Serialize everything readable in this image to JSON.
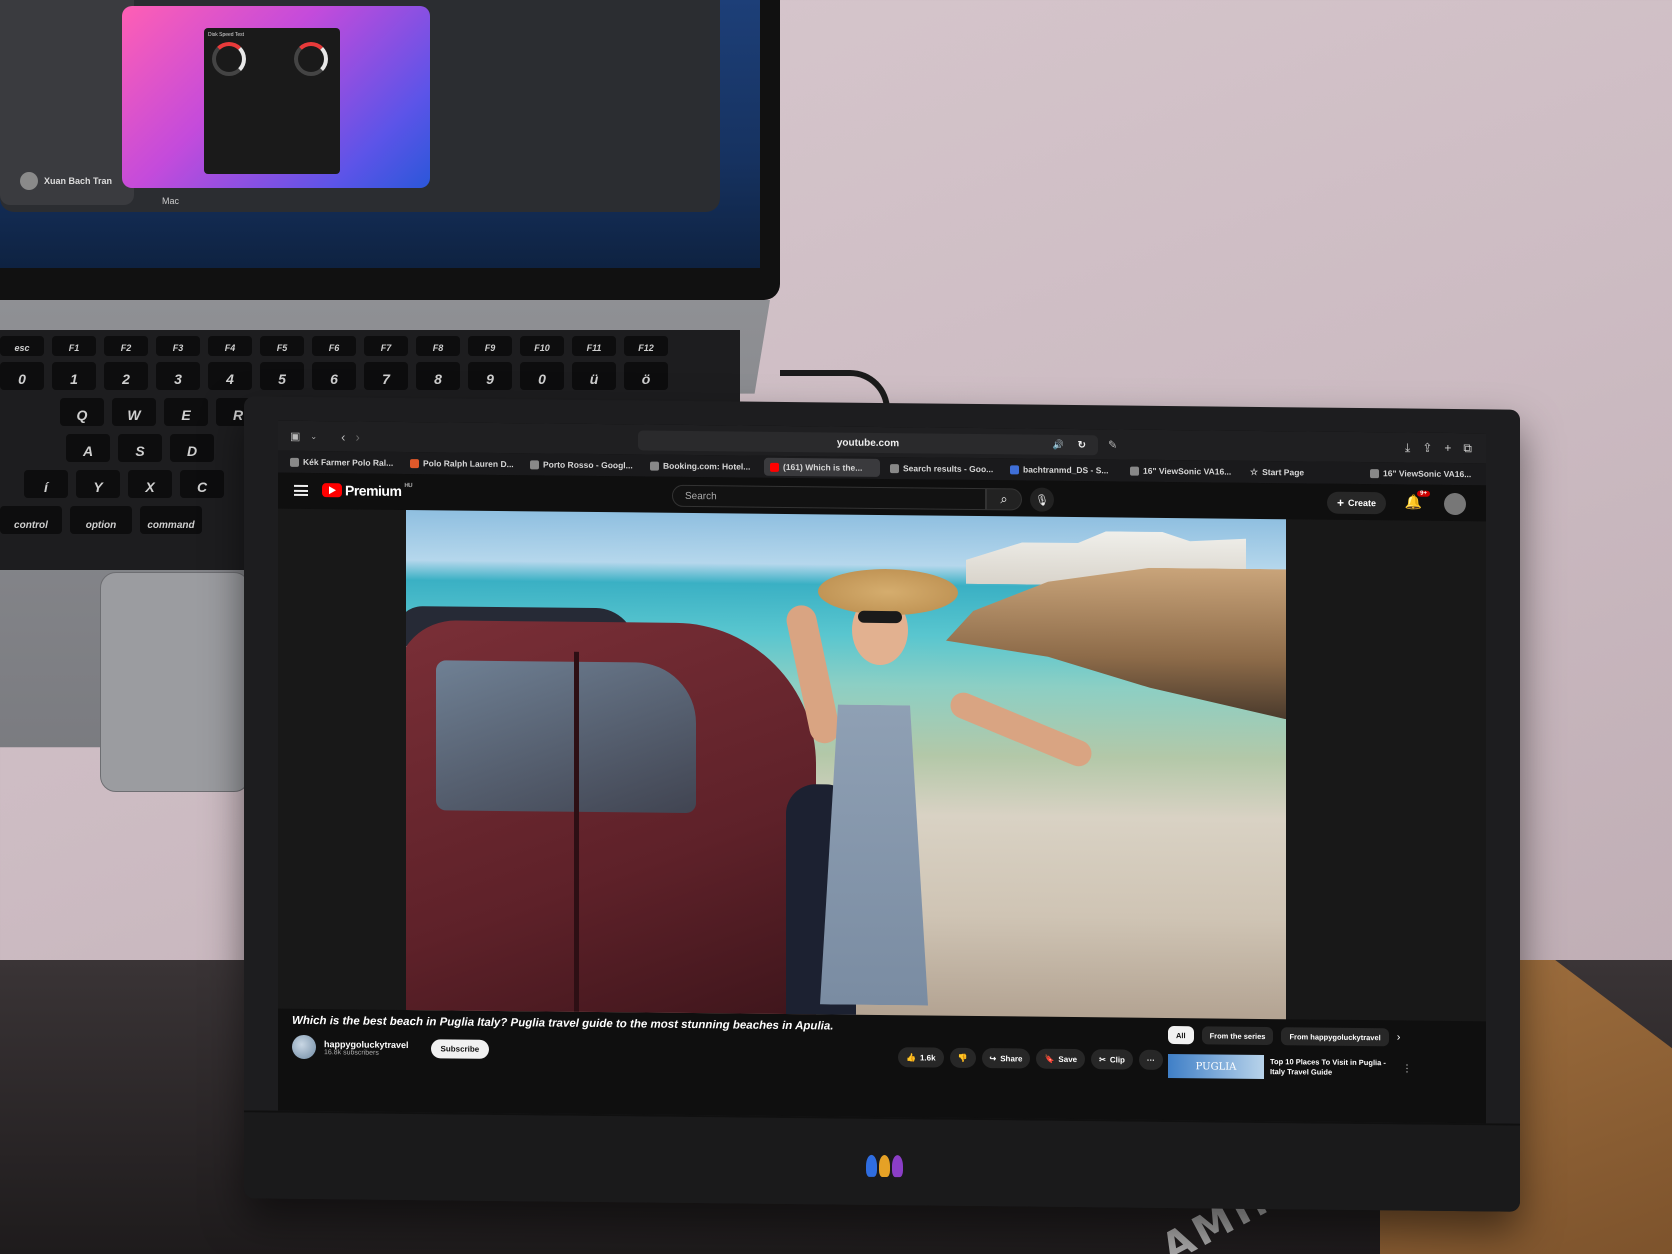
{
  "laptop": {
    "user_name": "Xuan Bach Tran",
    "mac_label": "Mac",
    "app_title": "Disk Speed Test",
    "keyboard_rows": [
      [
        "esc",
        "F1",
        "F2",
        "F3",
        "F4",
        "F5",
        "F6",
        "F7",
        "F8",
        "F9",
        "F10",
        "F11",
        "F12"
      ],
      [
        "0",
        "1",
        "2",
        "3",
        "4",
        "5",
        "6",
        "7",
        "8",
        "9",
        "0",
        "ü",
        "ö"
      ],
      [
        "Q",
        "W",
        "E",
        "R"
      ],
      [
        "A",
        "S",
        "D"
      ],
      [
        "í",
        "Y",
        "X",
        "C"
      ],
      [
        "control",
        "option",
        "command"
      ]
    ]
  },
  "browser": {
    "address": "youtube.com",
    "tabs": [
      {
        "label": "Kék Farmer Polo Ral..."
      },
      {
        "label": "Polo Ralph Lauren D..."
      },
      {
        "label": "Porto Rosso - Googl..."
      },
      {
        "label": "Booking.com: Hotel..."
      },
      {
        "label": "(161) Which is the...",
        "active": true
      },
      {
        "label": "Search results - Goo..."
      },
      {
        "label": "bachtranmd_DS - S..."
      },
      {
        "label": "16\" ViewSonic VA16..."
      },
      {
        "label": "Start Page"
      },
      {
        "label": "16\" ViewSonic VA16..."
      }
    ]
  },
  "youtube": {
    "logo_text": "Premium",
    "region": "HU",
    "search_placeholder": "Search",
    "create_label": "Create",
    "notifications": "9+",
    "video_title": "Which is the best beach in Puglia Italy? Puglia travel guide to the most stunning beaches in Apulia.",
    "channel_name": "happygoluckytravel",
    "subscribers": "16.8k subscribers",
    "subscribe_label": "Subscribe",
    "actions": {
      "likes": "1.6k",
      "share": "Share",
      "save": "Save",
      "clip": "Clip",
      "more": "···"
    },
    "chips": [
      "All",
      "From the series",
      "From happygoluckytravel"
    ],
    "up_next": {
      "thumb_text": "PUGLIA",
      "title": "Top 10 Places To Visit in Puglia - Italy Travel Guide"
    }
  }
}
